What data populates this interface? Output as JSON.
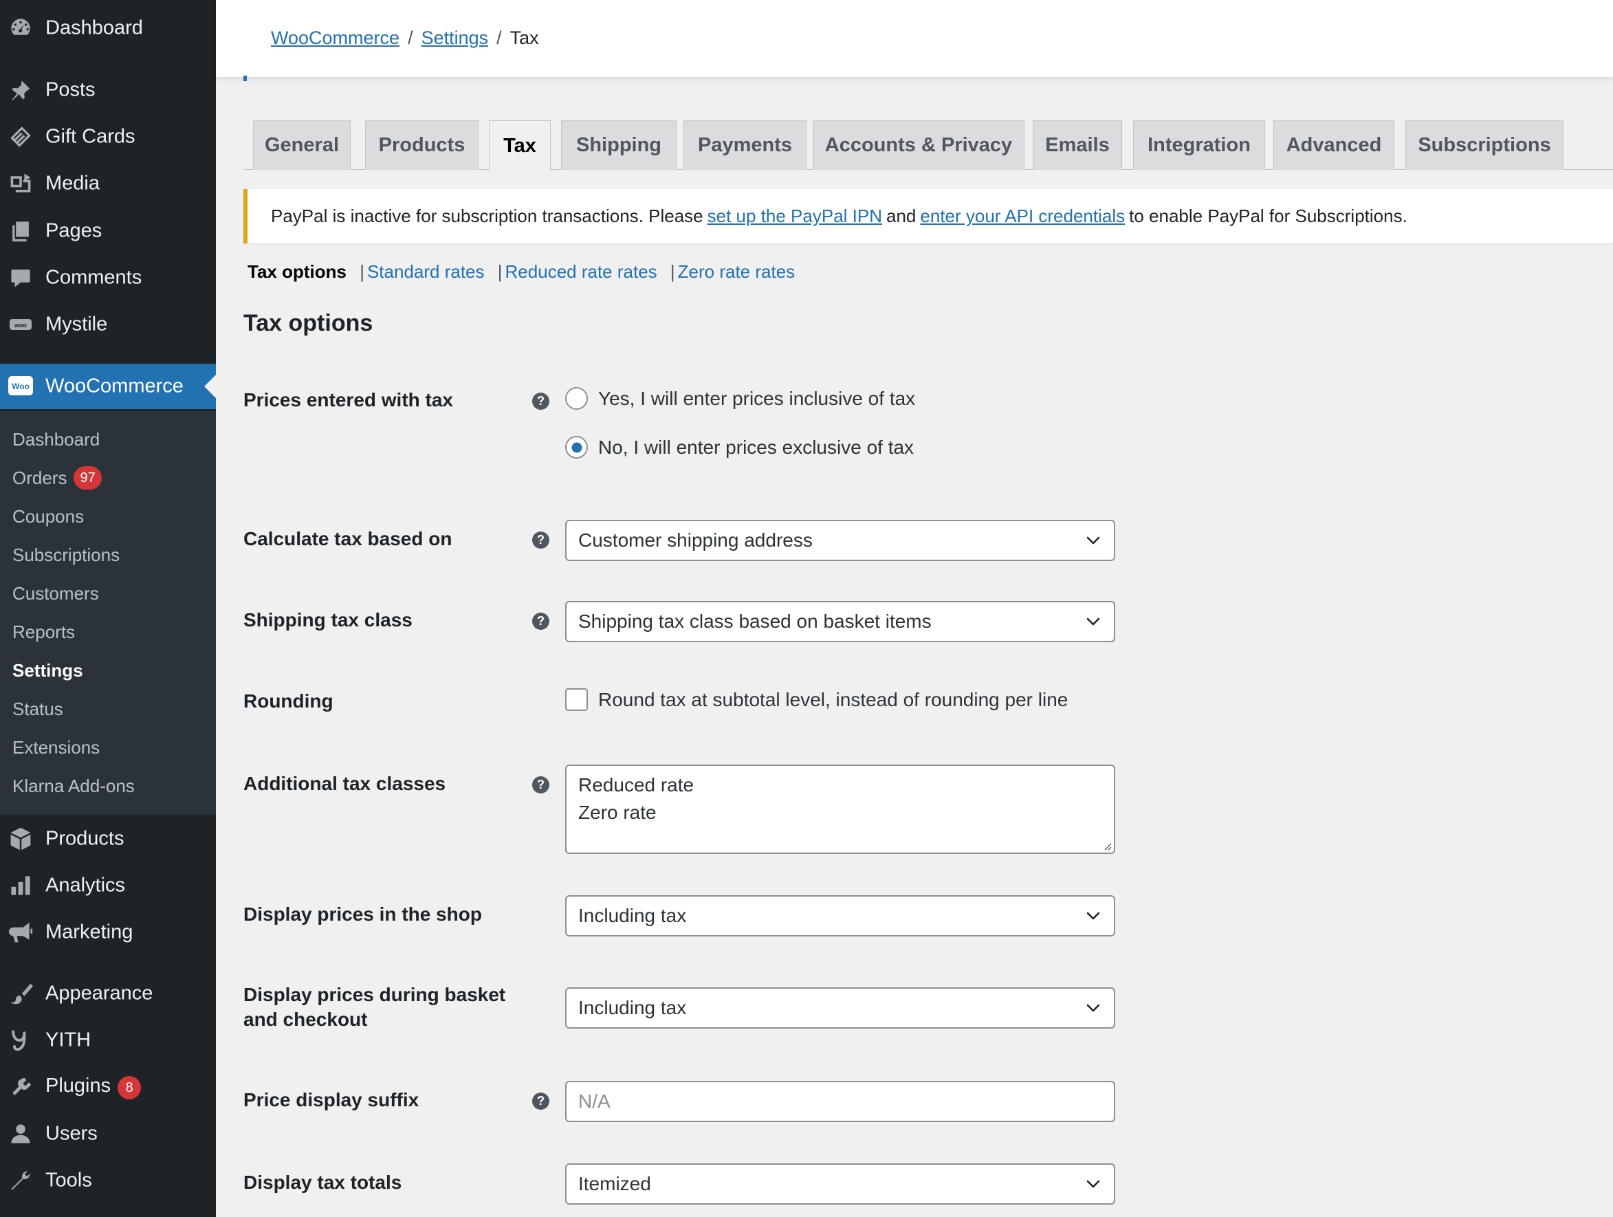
{
  "sidebar": {
    "top_items": [
      {
        "label": "Dashboard",
        "icon": "dashboard-icon"
      },
      {
        "label": "Posts",
        "icon": "pin-icon"
      },
      {
        "label": "Gift Cards",
        "icon": "gift-card-icon"
      },
      {
        "label": "Media",
        "icon": "media-icon"
      },
      {
        "label": "Pages",
        "icon": "pages-icon"
      },
      {
        "label": "Comments",
        "icon": "comment-icon"
      },
      {
        "label": "Mystile",
        "icon": "woo-theme-icon"
      }
    ],
    "woocommerce": {
      "label": "WooCommerce",
      "icon": "woocommerce-icon",
      "logo_text": "Woo"
    },
    "submenu": [
      {
        "label": "Dashboard"
      },
      {
        "label": "Orders",
        "badge": "97"
      },
      {
        "label": "Coupons"
      },
      {
        "label": "Subscriptions"
      },
      {
        "label": "Customers"
      },
      {
        "label": "Reports"
      },
      {
        "label": "Settings"
      },
      {
        "label": "Status"
      },
      {
        "label": "Extensions"
      },
      {
        "label": "Klarna Add-ons"
      }
    ],
    "bottom_items": [
      {
        "label": "Products",
        "icon": "box-icon"
      },
      {
        "label": "Analytics",
        "icon": "bar-chart-icon"
      },
      {
        "label": "Marketing",
        "icon": "megaphone-icon"
      },
      {
        "label": "Appearance",
        "icon": "paintbrush-icon"
      },
      {
        "label": "YITH",
        "icon": "yith-icon"
      },
      {
        "label": "Plugins",
        "icon": "plugin-icon",
        "badge": "8"
      },
      {
        "label": "Users",
        "icon": "user-icon"
      },
      {
        "label": "Tools",
        "icon": "wrench-icon"
      }
    ],
    "colors": {
      "bg": "#1d2327",
      "submenu_bg": "#2c3338",
      "accent": "#2271b1",
      "badge": "#d63638"
    }
  },
  "breadcrumb": {
    "items": [
      "WooCommerce",
      "Settings"
    ],
    "current": "Tax",
    "separator": "/"
  },
  "tabs": [
    "General",
    "Products",
    "Tax",
    "Shipping",
    "Payments",
    "Accounts & Privacy",
    "Emails",
    "Integration",
    "Advanced",
    "Subscriptions"
  ],
  "active_tab": "Tax",
  "notice": {
    "text_before": "PayPal is inactive for subscription transactions. Please",
    "link1": "set up the PayPal IPN",
    "text_mid": "and",
    "link2": "enter your API credentials",
    "text_after": "to enable PayPal for Subscriptions.",
    "accent_color": "#dba617"
  },
  "subnav": {
    "current": "Tax options",
    "links": [
      "Standard rates",
      "Reduced rate rates",
      "Zero rate rates"
    ],
    "separator": "|"
  },
  "section_title": "Tax options",
  "fields": {
    "prices_entered": {
      "label": "Prices entered with tax",
      "options": [
        "Yes, I will enter prices inclusive of tax",
        "No, I will enter prices exclusive of tax"
      ],
      "selected": "No, I will enter prices exclusive of tax"
    },
    "calculate_based_on": {
      "label": "Calculate tax based on",
      "value": "Customer shipping address"
    },
    "shipping_tax_class": {
      "label": "Shipping tax class",
      "value": "Shipping tax class based on basket items"
    },
    "rounding": {
      "label": "Rounding",
      "checkbox_label": "Round tax at subtotal level, instead of rounding per line",
      "checked": false
    },
    "additional_classes": {
      "label": "Additional tax classes",
      "lines": [
        "Reduced rate",
        "Zero rate"
      ]
    },
    "display_shop": {
      "label": "Display prices in the shop",
      "value": "Including tax"
    },
    "display_cart": {
      "label_line1": "Display prices during basket",
      "label_line2": "and checkout",
      "value": "Including tax"
    },
    "price_suffix": {
      "label": "Price display suffix",
      "placeholder": "N/A"
    },
    "tax_totals": {
      "label": "Display tax totals",
      "value": "Itemized"
    }
  },
  "help_glyph": "?"
}
